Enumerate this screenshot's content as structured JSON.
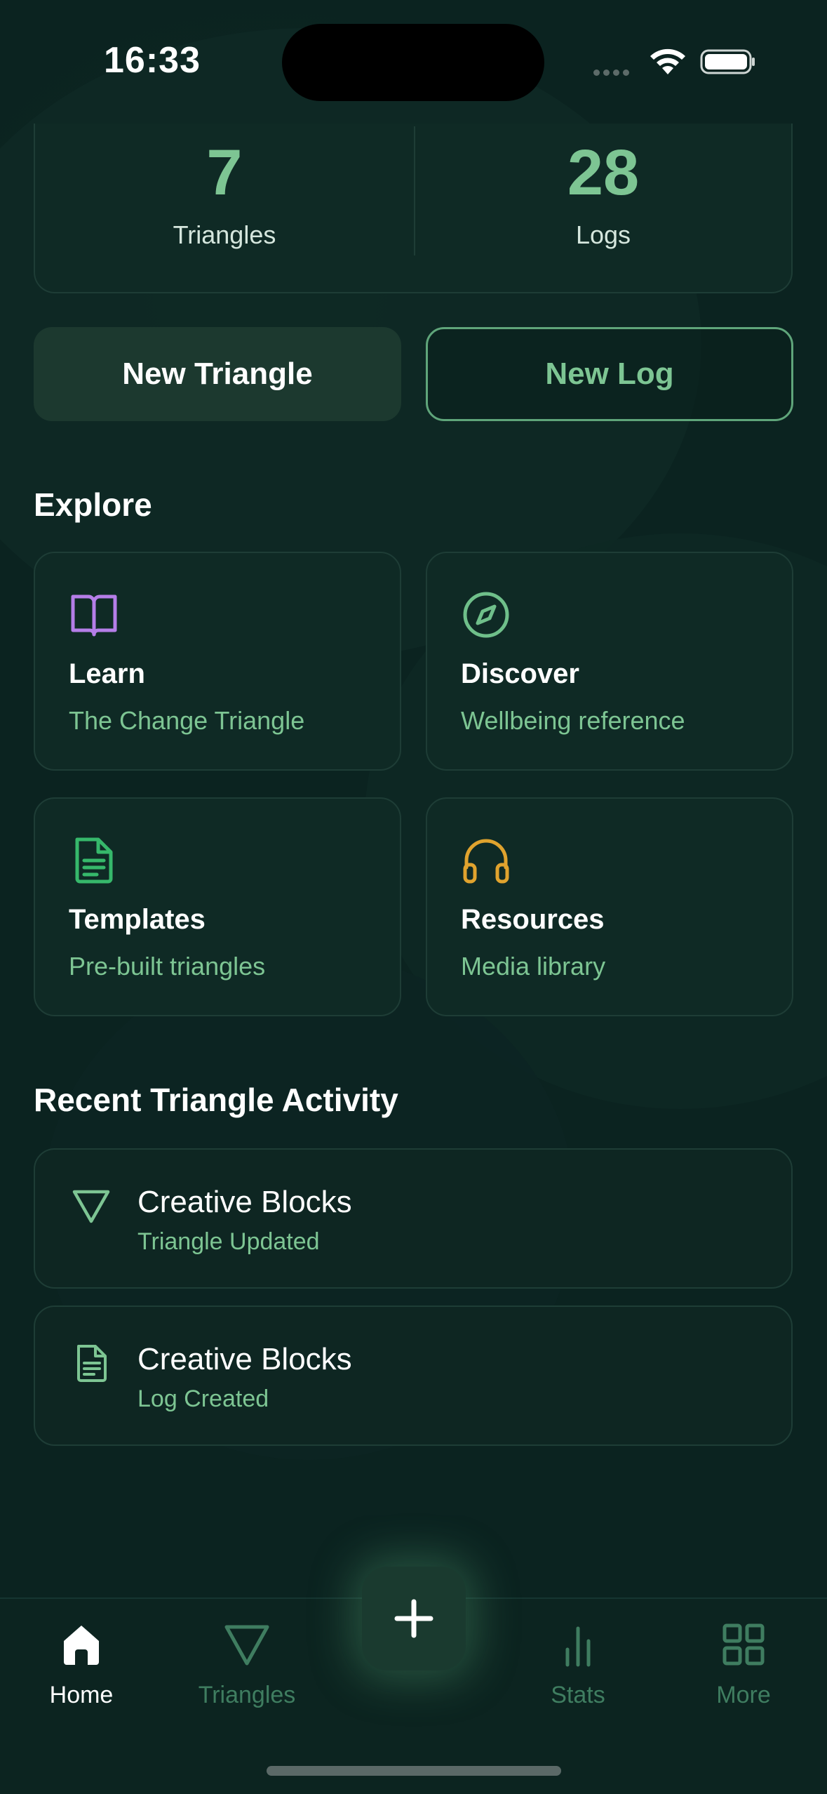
{
  "status_bar": {
    "time": "16:33"
  },
  "stats": [
    {
      "value": "7",
      "label": "Triangles"
    },
    {
      "value": "28",
      "label": "Logs"
    }
  ],
  "actions": {
    "new_triangle": "New Triangle",
    "new_log": "New Log"
  },
  "explore": {
    "title": "Explore",
    "tiles": [
      {
        "title": "Learn",
        "subtitle": "The Change Triangle",
        "icon": "book-icon",
        "color": "#b57ee8"
      },
      {
        "title": "Discover",
        "subtitle": "Wellbeing reference",
        "icon": "compass-icon",
        "color": "#6fbf8a"
      },
      {
        "title": "Templates",
        "subtitle": "Pre-built triangles",
        "icon": "document-icon",
        "color": "#36b86b"
      },
      {
        "title": "Resources",
        "subtitle": "Media library",
        "icon": "headphones-icon",
        "color": "#e0a32e"
      }
    ]
  },
  "recent": {
    "title": "Recent Triangle Activity",
    "items": [
      {
        "title": "Creative Blocks",
        "subtitle": "Triangle Updated",
        "icon": "triangle-icon"
      },
      {
        "title": "Creative Blocks",
        "subtitle": "Log Created",
        "icon": "document-icon"
      }
    ]
  },
  "tabbar": {
    "tabs": [
      {
        "label": "Home",
        "icon": "home-icon",
        "active": true
      },
      {
        "label": "Triangles",
        "icon": "triangle-icon",
        "active": false
      },
      {
        "label": "Stats",
        "icon": "bar-chart-icon",
        "active": false
      },
      {
        "label": "More",
        "icon": "grid-icon",
        "active": false
      }
    ],
    "fab_icon": "plus-icon"
  },
  "colors": {
    "accent": "#7dc593",
    "background": "#0b2320",
    "card": "#0f2a25"
  }
}
